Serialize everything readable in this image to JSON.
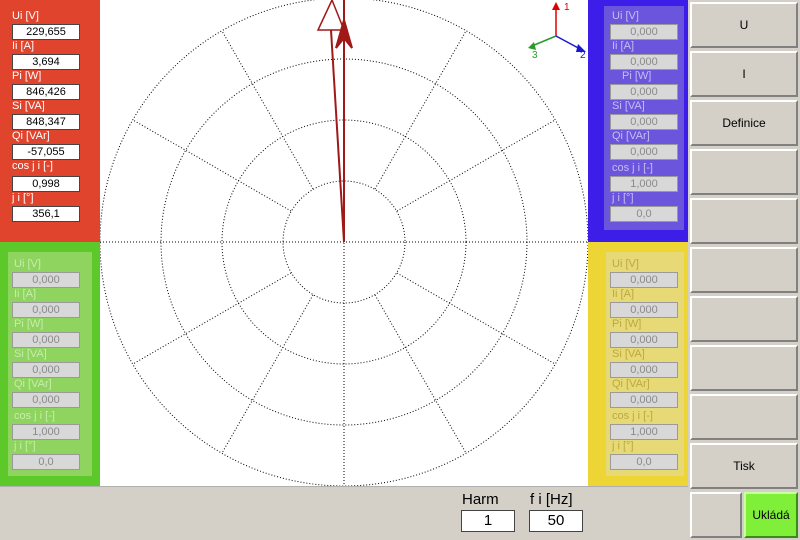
{
  "phase1": {
    "ui_label": "Ui [V]",
    "ui_value": "229,655",
    "ii_label": "Ii [A]",
    "ii_value": "3,694",
    "pi_label": "Pi [W]",
    "pi_value": "846,426",
    "si_label": "Si [VA]",
    "si_value": "848,347",
    "qi_label": "Qi [VAr]",
    "qi_value": "-57,055",
    "cos_label": "cos j i [-]",
    "cos_value": "0,998",
    "phi_label": "j i [°]",
    "phi_value": "356,1"
  },
  "phase2": {
    "ui_label": "Ui [V]",
    "ui_value": "0,000",
    "ii_label": "Ii [A]",
    "ii_value": "0,000",
    "pi_label": "Pi [W]",
    "pi_value": "0,000",
    "si_label": "Si [VA]",
    "si_value": "0,000",
    "qi_label": "Qi [VAr]",
    "qi_value": "0,000",
    "cos_label": "cos j i [-]",
    "cos_value": "1,000",
    "phi_label": "j i [°]",
    "phi_value": "0,0"
  },
  "phase3": {
    "ui_label": "Ui [V]",
    "ui_value": "0,000",
    "ii_label": "Ii [A]",
    "ii_value": "0,000",
    "pi_label": "Pi [W]",
    "pi_value": "0,000",
    "si_label": "Si [VA]",
    "si_value": "0,000",
    "qi_label": "Qi [VAr]",
    "qi_value": "0,000",
    "cos_label": "cos j i [-]",
    "cos_value": "1,000",
    "phi_label": "j i [°]",
    "phi_value": "0,0"
  },
  "phase4": {
    "ui_label": "Ui [V]",
    "ui_value": "0,000",
    "ii_label": "Ii [A]",
    "ii_value": "0,000",
    "pi_label": "Pi [W]",
    "pi_value": "0,000",
    "si_label": "Si [VA]",
    "si_value": "0,000",
    "qi_label": "Qi [VAr]",
    "qi_value": "0,000",
    "cos_label": "cos j i [-]",
    "cos_value": "1,000",
    "phi_label": "j i [°]",
    "phi_value": "0,0"
  },
  "axes": {
    "axis1": "1",
    "axis2": "2",
    "axis3": "3"
  },
  "buttons": {
    "u": "U",
    "i": "I",
    "definice": "Definice",
    "tisk": "Tisk",
    "uklada": "Ukládá"
  },
  "bottom": {
    "harm_label": "Harm",
    "harm_value": "1",
    "freq_label": "f i [Hz]",
    "freq_value": "50"
  },
  "phasor": {
    "voltage_angle_deg": 356.1,
    "current_angle_deg": 356.1,
    "color": "#a01818"
  },
  "colors": {
    "phase1": "#e0442c",
    "phase2": "#3d1de8",
    "phase3": "#5dc829",
    "phase4": "#eed536",
    "save": "#80ef3a"
  }
}
